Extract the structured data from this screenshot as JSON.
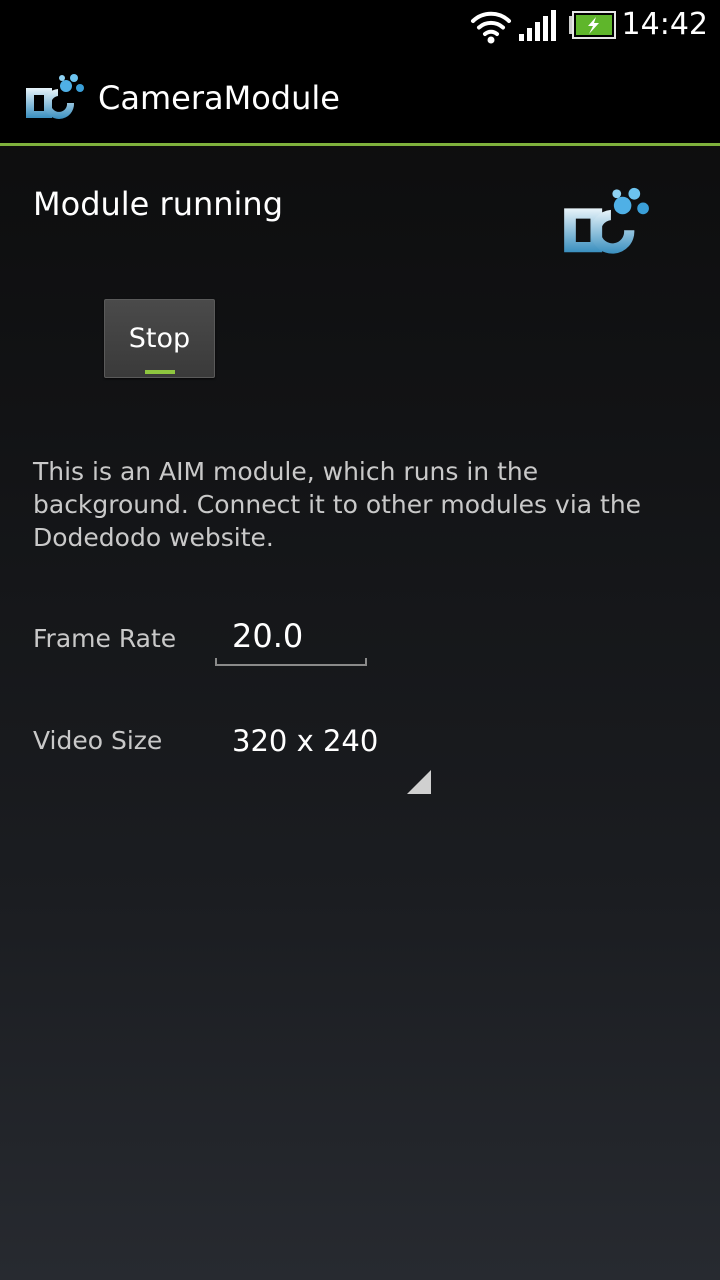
{
  "status_bar": {
    "time": "14:42",
    "icons": [
      "wifi-icon",
      "cell-signal-icon",
      "battery-charging-icon"
    ]
  },
  "action_bar": {
    "app_title": "CameraModule",
    "logo_icon": "dobots-logo-icon"
  },
  "content": {
    "status_text": "Module running",
    "logo_icon": "dobots-logo-icon",
    "stop_button_label": "Stop",
    "description": "This is an AIM module, which runs in the background. Connect it to other modules via the Dodedodo website.",
    "frame_rate_label": "Frame Rate",
    "frame_rate_value": "20.0",
    "video_size_label": "Video Size",
    "video_size_value": "320 x 240"
  },
  "colors": {
    "accent_green": "#7fb13c",
    "button_indicator": "#8ec63f",
    "background_top": "#0b0b0b",
    "background_bottom": "#272a30"
  }
}
